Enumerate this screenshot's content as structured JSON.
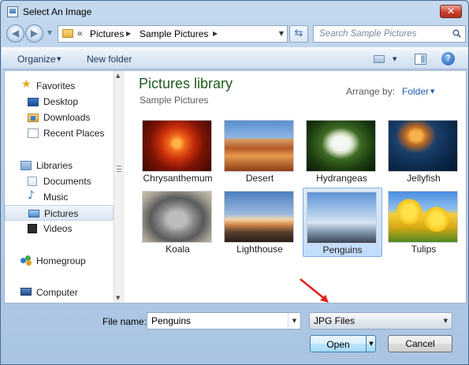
{
  "window": {
    "title": "Select An Image",
    "close_glyph": "✕"
  },
  "navigation": {
    "back_glyph": "◀",
    "forward_glyph": "▶",
    "chevron_glyph": "«",
    "breadcrumbs": [
      "Pictures",
      "Sample Pictures"
    ],
    "search_placeholder": "Search Sample Pictures",
    "refresh_glyph": "⇆"
  },
  "toolbar": {
    "organize_label": "Organize",
    "new_folder_label": "New folder",
    "help_glyph": "?"
  },
  "sidebar": {
    "favorites": {
      "label": "Favorites",
      "icon": "star-icon",
      "icon_glyph": "★"
    },
    "favorite_items": [
      {
        "label": "Desktop",
        "icon": "desktop-icon"
      },
      {
        "label": "Downloads",
        "icon": "downloads-icon"
      },
      {
        "label": "Recent Places",
        "icon": "recent-places-icon"
      }
    ],
    "libraries": {
      "label": "Libraries",
      "icon": "libraries-icon"
    },
    "library_items": [
      {
        "label": "Documents",
        "icon": "documents-icon"
      },
      {
        "label": "Music",
        "icon": "music-icon",
        "icon_glyph": "♪"
      },
      {
        "label": "Pictures",
        "icon": "pictures-icon",
        "selected": true
      },
      {
        "label": "Videos",
        "icon": "videos-icon"
      }
    ],
    "homegroup": {
      "label": "Homegroup",
      "icon": "homegroup-icon"
    },
    "computer": {
      "label": "Computer",
      "icon": "computer-icon"
    }
  },
  "library": {
    "title": "Pictures library",
    "subtitle": "Sample Pictures",
    "arrange_label": "Arrange by:",
    "arrange_value": "Folder"
  },
  "files": [
    {
      "name": "Chrysanthemum"
    },
    {
      "name": "Desert"
    },
    {
      "name": "Hydrangeas"
    },
    {
      "name": "Jellyfish"
    },
    {
      "name": "Koala"
    },
    {
      "name": "Lighthouse"
    },
    {
      "name": "Penguins",
      "selected": true
    },
    {
      "name": "Tulips"
    }
  ],
  "footer": {
    "file_name_label": "File name:",
    "file_name_value": "Penguins",
    "file_type_value": "JPG Files",
    "open_label": "Open",
    "cancel_label": "Cancel"
  },
  "colors": {
    "accent": "#1e5d1e",
    "link": "#1e5bb0",
    "selection": "#c1dcfc",
    "annotation_arrow": "#e0201a"
  }
}
